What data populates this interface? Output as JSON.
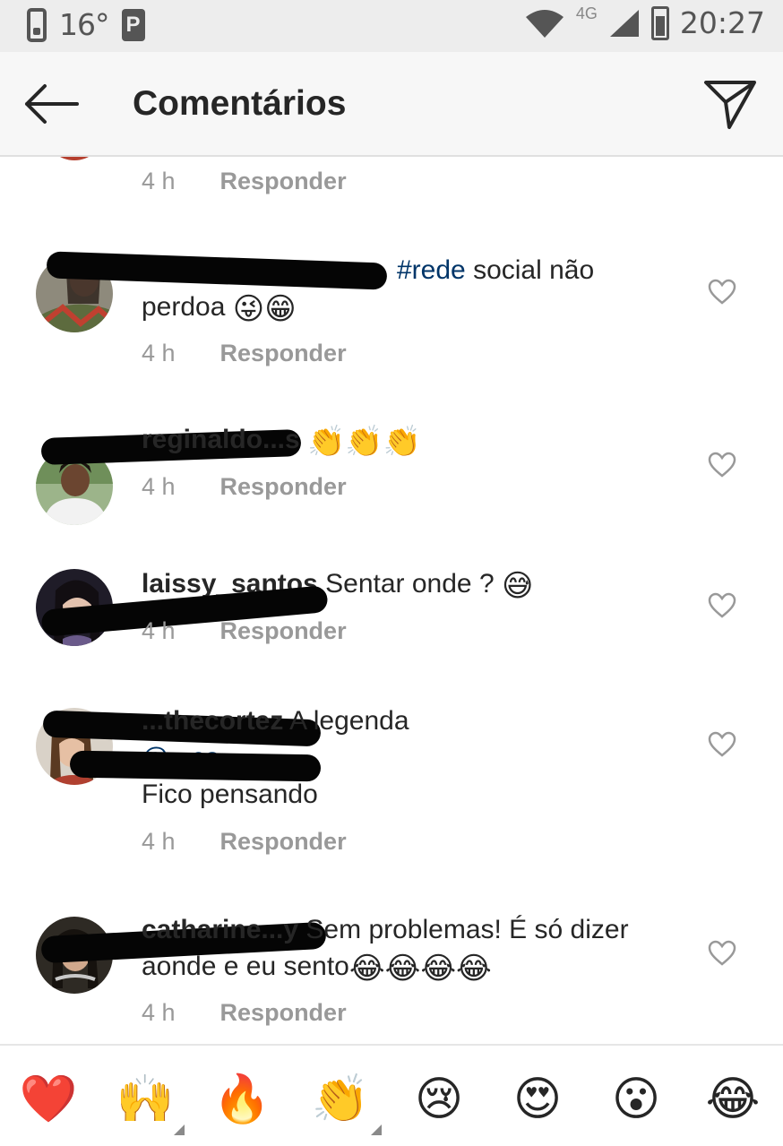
{
  "status_bar": {
    "temperature": "16°",
    "network": "4G",
    "time": "20:27"
  },
  "header": {
    "title": "Comentários"
  },
  "comments": [
    {
      "username": "",
      "text": "",
      "time": "4 h",
      "reply": "Responder"
    },
    {
      "username": "",
      "hashtag": "#rede",
      "text": "social não perdoa",
      "emojis": "😜😁",
      "time": "4 h",
      "reply": "Responder"
    },
    {
      "username": "reginaldo...s",
      "text": "",
      "emojis": "👏👏👏",
      "time": "4 h",
      "reply": "Responder"
    },
    {
      "username": "laissy_santos",
      "text": "Sentar onde ?",
      "emojis": "😅",
      "time": "4 h",
      "reply": "Responder"
    },
    {
      "username": "...thecortez",
      "text": "A legenda",
      "mention": "@...co",
      "text2": "Fico pensando",
      "time": "4 h",
      "reply": "Responder"
    },
    {
      "username": "catharine...y",
      "text": "Sem problemas! É só dizer aonde e eu sento",
      "emojis": "😂😂😂😂",
      "time": "4 h",
      "reply": "Responder"
    }
  ],
  "emoji_bar": [
    {
      "emoji": "❤️",
      "name": "heart"
    },
    {
      "emoji": "🙌",
      "name": "raising-hands"
    },
    {
      "emoji": "🔥",
      "name": "fire"
    },
    {
      "emoji": "👏",
      "name": "clapping-hands"
    },
    {
      "emoji": "😢",
      "name": "crying-face"
    },
    {
      "emoji": "😍",
      "name": "heart-eyes"
    },
    {
      "emoji": "😮",
      "name": "surprised-face"
    },
    {
      "emoji": "😂",
      "name": "tears-of-joy"
    }
  ],
  "colors": {
    "header_bg": "#f7f7f7",
    "status_bg": "#ededed",
    "link_blue": "#003569",
    "meta_gray": "#999999"
  }
}
